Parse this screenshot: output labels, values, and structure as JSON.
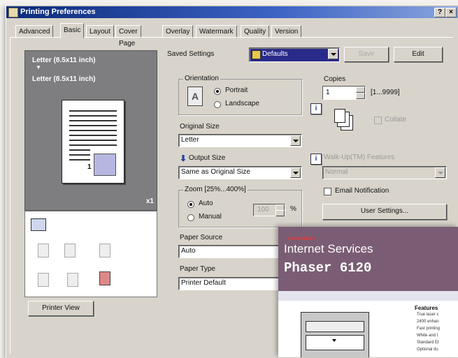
{
  "window": {
    "title": "Printing Preferences",
    "help": "?",
    "close": "×"
  },
  "tabs": [
    "Advanced",
    "Basic",
    "Layout",
    "Cover Page",
    "Overlay",
    "Watermark",
    "Quality",
    "Version"
  ],
  "preview": {
    "line1": "Letter (8.5x11 inch)",
    "arrow": "▼",
    "line2": "Letter (8.5x11 inch)",
    "page_num": "1",
    "count": "x1",
    "printer_view_label": "Printer View"
  },
  "saved_settings": {
    "label": "Saved Settings",
    "value": "Defaults",
    "save_label": "Save",
    "edit_label": "Edit"
  },
  "orientation": {
    "label": "Orientation",
    "portrait": "Portrait",
    "landscape": "Landscape",
    "selected": "Portrait",
    "icon_letter": "A"
  },
  "original_size": {
    "label": "Original Size",
    "value": "Letter"
  },
  "output_size": {
    "label": "Output Size",
    "value": "Same as Original Size"
  },
  "zoom": {
    "label": "Zoom [25%...400%]",
    "auto": "Auto",
    "manual": "Manual",
    "value": "100",
    "unit": "%"
  },
  "paper_source": {
    "label": "Paper Source",
    "value": "Auto"
  },
  "paper_type": {
    "label": "Paper Type",
    "value": "Printer Default"
  },
  "copies": {
    "label": "Copies",
    "value": "1",
    "range": "[1...9999]",
    "collate": "Collate",
    "info": "i"
  },
  "walkup": {
    "label": "Walk-Up(TM) Features",
    "value": "Normal",
    "email": "Email Notification",
    "user_settings": "User Settings..."
  },
  "overlay": {
    "brand": "CentreWare",
    "title1": "Internet Services",
    "title2": "Phaser 6120",
    "features_label": "Features",
    "features": [
      "True laser c",
      "2400 enhan",
      "Fast printing",
      "White and t",
      "Standard Et",
      "Optional du"
    ]
  },
  "colors": {
    "titlebar": "#0a2a7a",
    "overlay_header": "#7a5d74",
    "preview_bg": "#7e7e80"
  }
}
